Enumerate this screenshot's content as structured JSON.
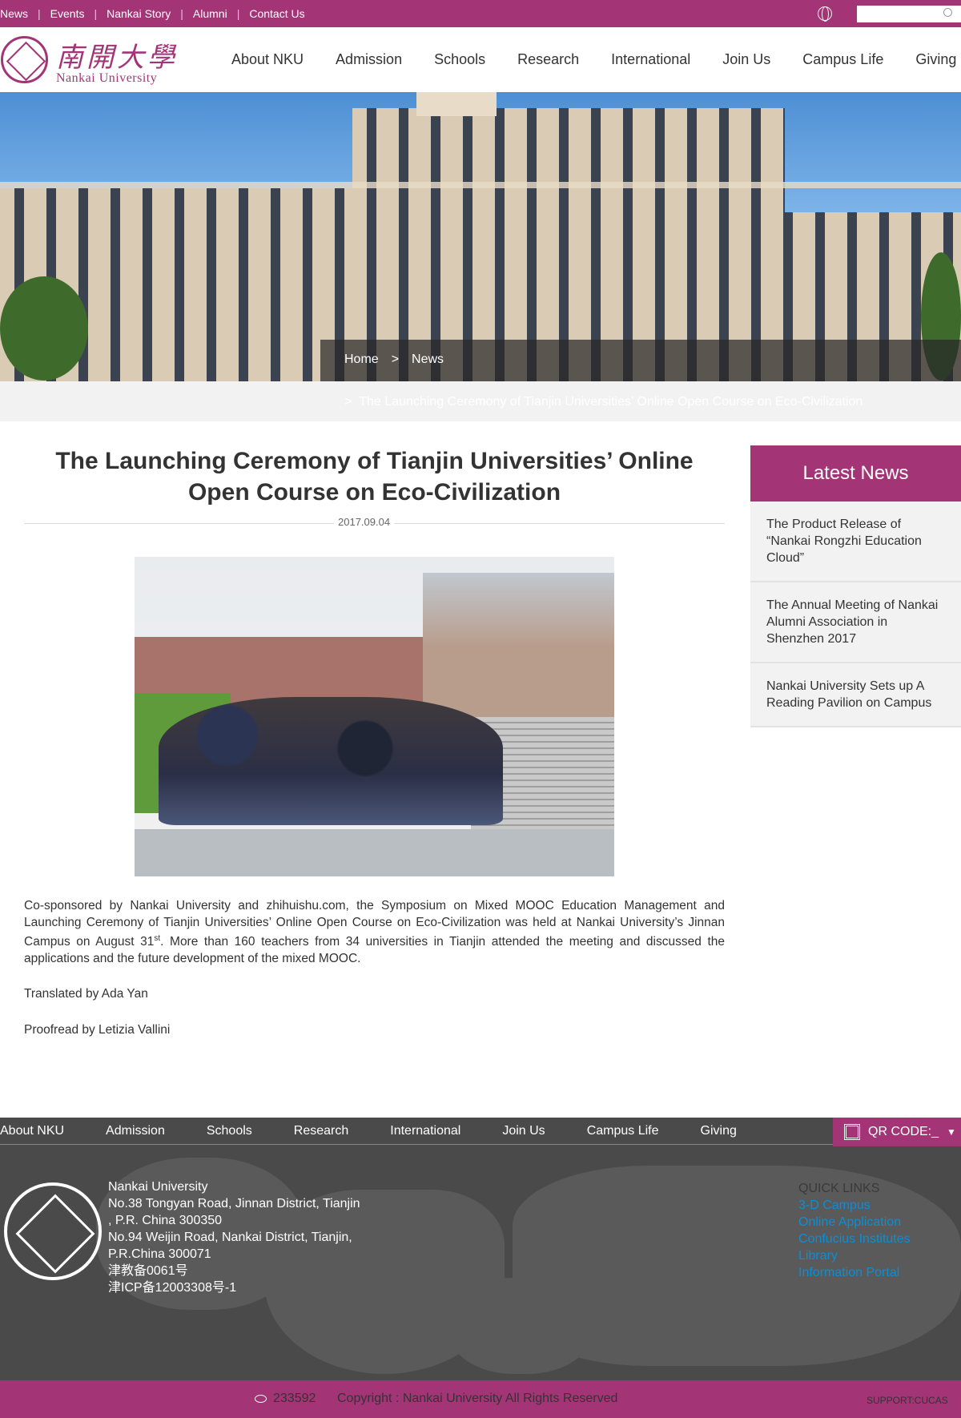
{
  "topbar": {
    "links": [
      "News",
      "Events",
      "Nankai Story",
      "Alumni",
      "Contact Us"
    ],
    "search_placeholder": "",
    "icons": [
      "globe-icon",
      "search-icon"
    ]
  },
  "brand": {
    "cn": "南開大學",
    "en": "Nankai University",
    "accent": "#a33577"
  },
  "nav": [
    "About NKU",
    "Admission",
    "Schools",
    "Research",
    "International",
    "Join Us",
    "Campus Life",
    "Giving"
  ],
  "breadcrumb": {
    "home": "Home",
    "sep": ">",
    "current": "News",
    "article_sep": ">",
    "article": "The Launching Ceremony of Tianjin Universities’ Online Open Course on Eco-Civilization"
  },
  "article": {
    "title": "The Launching Ceremony of Tianjin Universities’ Online Open Course on Eco-Civilization",
    "date": "2017.09.04",
    "body_pre": "Co-sponsored by Nankai University and zhihuishu.com, the Symposium on Mixed MOOC Education Management and Launching Ceremony of Tianjin Universities’ Online Open Course on Eco-Civilization was held at Nankai University’s Jinnan Campus on August 31",
    "body_sup": "st",
    "body_post": ". More than 160 teachers from 34 universities in Tianjin attended the meeting and discussed the applications and the future development of the mixed MOOC.",
    "translated": "Translated by Ada Yan",
    "proofread": "Proofread by Letizia Vallini"
  },
  "sidebar": {
    "title": "Latest News",
    "items": [
      "The Product Release of “Nankai Rongzhi Education Cloud”",
      "The Annual Meeting of Nankai Alumni Association in Shenzhen 2017",
      "Nankai University Sets up A Reading Pavilion on Campus"
    ]
  },
  "footer": {
    "nav": [
      "About NKU",
      "Admission",
      "Schools",
      "Research",
      "International",
      "Join Us",
      "Campus Life",
      "Giving"
    ],
    "qr_label": "QR CODE:_",
    "address": [
      "Nankai University",
      "No.38 Tongyan Road, Jinnan District, Tianjin",
      ", P.R. China 300350",
      "No.94 Weijin Road,  Nankai District, Tianjin,",
      "P.R.China  300071",
      "津教备0061号",
      "津ICP备12003308号-1"
    ],
    "quick_links_title": "QUICK LINKS",
    "quick_links": [
      "3-D Campus",
      "Online Application",
      "Confucius Institutes",
      "Library",
      "Information Portal"
    ],
    "visits": "233592",
    "copyright": "Copyright : Nankai University All Rights Reserved",
    "support": "SUPPORT:CUCAS"
  }
}
